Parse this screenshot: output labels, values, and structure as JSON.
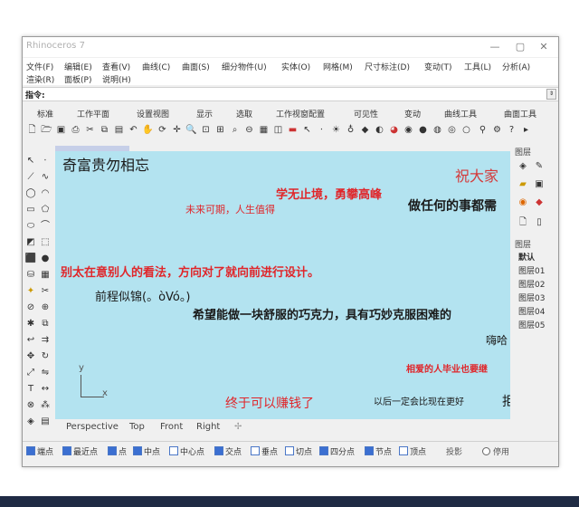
{
  "window": {
    "title": "Rhinoceros 7",
    "buttons": [
      "—",
      "▢",
      "✕"
    ]
  },
  "menu": {
    "row1": [
      "文件(F)",
      "编辑(E)",
      "查看(V)",
      "曲线(C)",
      "曲面(S)",
      "细分物件(U)",
      "实体(O)",
      "网格(M)",
      "尺寸标注(D)",
      "变动(T)",
      "工具(L)",
      "分析(A)"
    ],
    "row2": [
      "渲染(R)",
      "面板(P)",
      "说明(H)"
    ]
  },
  "command": {
    "label": "指令:",
    "value": ""
  },
  "tabs": [
    "标准",
    "工作平面",
    "设置视图",
    "显示",
    "选取",
    "工作视窗配置",
    "可见性",
    "变动",
    "曲线工具",
    "曲面工具"
  ],
  "viewport": {
    "texts": [
      {
        "text": "奇富贵勿相忘",
        "color": "#1a1a1a",
        "size": 16,
        "bold": false
      },
      {
        "text": "祝大家",
        "color": "#d43a3a",
        "size": 16,
        "bold": false
      },
      {
        "text": "学无止境，勇攀高峰",
        "color": "#e0262a",
        "size": 13,
        "bold": true
      },
      {
        "text": "做任何的事都需",
        "color": "#1a1a1a",
        "size": 14,
        "bold": true
      },
      {
        "text": "未来可期，人生值得",
        "color": "#e0262a",
        "size": 11,
        "bold": false
      },
      {
        "text": "别太在意别人的看法，方向对了就向前进行设计。",
        "color": "#e0262a",
        "size": 13,
        "bold": true
      },
      {
        "text": "前程似锦(。òVó。)",
        "color": "#1a1a1a",
        "size": 13,
        "bold": false
      },
      {
        "text": "希望能做一块舒服的巧克力，具有巧妙克服困难的",
        "color": "#1a1a1a",
        "size": 13,
        "bold": true
      },
      {
        "text": "嗨哈",
        "color": "#1a1a1a",
        "size": 12,
        "bold": false
      },
      {
        "text": "相爱的人毕业也要继",
        "color": "#e0262a",
        "size": 10,
        "bold": true
      },
      {
        "text": "终于可以赚钱了",
        "color": "#e0262a",
        "size": 14,
        "bold": false
      },
      {
        "text": "以后一定会比现在更好",
        "color": "#1a1a1a",
        "size": 10,
        "bold": false
      },
      {
        "text": "拒",
        "color": "#1a1a1a",
        "size": 14,
        "bold": false
      }
    ],
    "axis_y": "y",
    "axis_x": "x"
  },
  "view_tabs": [
    "Perspective",
    "Top",
    "Front",
    "Right",
    "✢"
  ],
  "right_panel": {
    "layers_title": "图层",
    "display_title": "图层",
    "layers": [
      "默认",
      "图层01",
      "图层02",
      "图层03",
      "图层04",
      "图层05"
    ]
  },
  "snaps": [
    {
      "label": "端点",
      "checked": true
    },
    {
      "label": "最近点",
      "checked": true
    },
    {
      "label": "点",
      "checked": true
    },
    {
      "label": "中点",
      "checked": true
    },
    {
      "label": "中心点",
      "checked": false
    },
    {
      "label": "交点",
      "checked": true
    },
    {
      "label": "垂点",
      "checked": false
    },
    {
      "label": "切点",
      "checked": false
    },
    {
      "label": "四分点",
      "checked": true
    },
    {
      "label": "节点",
      "checked": true
    },
    {
      "label": "顶点",
      "checked": false
    },
    {
      "label": "投影",
      "checked": false
    },
    {
      "label": "停用",
      "checked": false
    }
  ]
}
